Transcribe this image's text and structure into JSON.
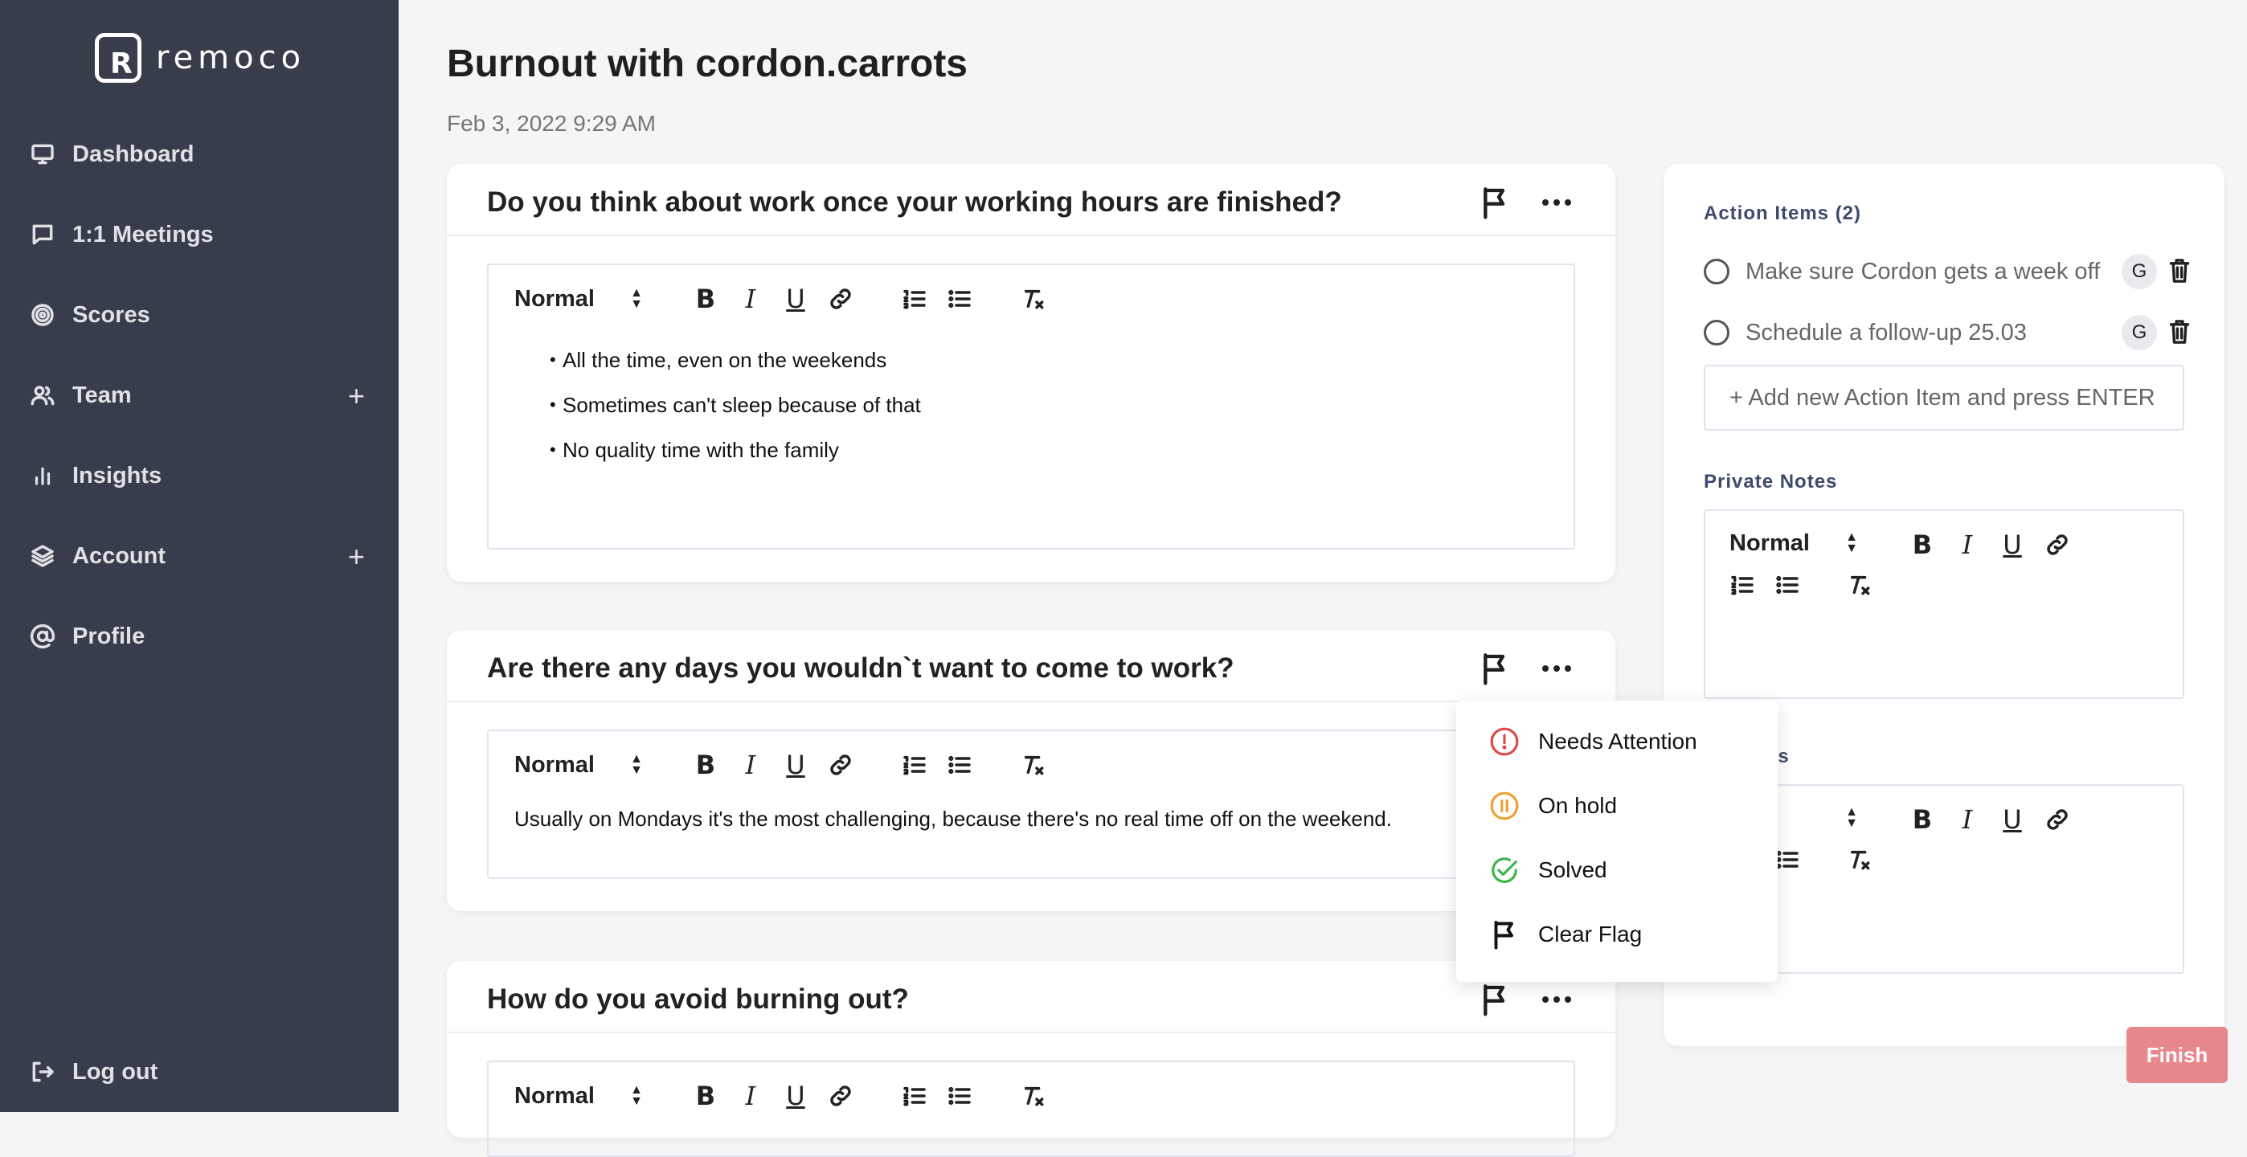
{
  "brand": {
    "name": "remoco",
    "mark": "R"
  },
  "sidebar": {
    "items": [
      {
        "label": "Dashboard",
        "icon": "monitor-icon"
      },
      {
        "label": "1:1 Meetings",
        "icon": "chat-icon"
      },
      {
        "label": "Scores",
        "icon": "target-icon"
      },
      {
        "label": "Team",
        "icon": "users-icon",
        "expand": "+"
      },
      {
        "label": "Insights",
        "icon": "bar-chart-icon"
      },
      {
        "label": "Account",
        "icon": "layers-icon",
        "expand": "+"
      },
      {
        "label": "Profile",
        "icon": "at-icon"
      }
    ],
    "logout": "Log out"
  },
  "meeting": {
    "title": "Burnout with cordon.carrots",
    "date": "Feb 3, 2022 9:29 AM"
  },
  "toolbar": {
    "format": "Normal",
    "bold": "B",
    "italic": "I",
    "underline": "U"
  },
  "questions": [
    {
      "question": "Do you think about work once your working hours are finished?",
      "bullets": [
        "All the time, even on the weekends",
        "Sometimes can't sleep because of that",
        "No quality time with the family"
      ]
    },
    {
      "question": "Are there any days you wouldn`t want to come to work?",
      "text": "Usually on Mondays it's the most challenging, because there's no real time off on the weekend."
    },
    {
      "question": "How do you avoid burning out?"
    }
  ],
  "flag_menu": {
    "items": [
      {
        "label": "Needs Attention",
        "color": "#e04848"
      },
      {
        "label": "On hold",
        "color": "#f0a030"
      },
      {
        "label": "Solved",
        "color": "#3cb54a"
      },
      {
        "label": "Clear Flag",
        "color": "#222222"
      }
    ]
  },
  "right_panel": {
    "action_items_title": "Action Items (2)",
    "action_items": [
      {
        "text": "Make sure Cordon gets a week off",
        "assignee": "G"
      },
      {
        "text": "Schedule a follow-up 25.03",
        "assignee": "G"
      }
    ],
    "add_placeholder": "+ Add new Action Item and press ENTER",
    "private_notes_title": "Private Notes",
    "shared_notes_title_visible": "Notes",
    "shared_notes_format_visible": "rmal"
  },
  "finish_label": "Finish",
  "colors": {
    "sidebar_bg": "#373d4a",
    "finish_bg": "#e8878c",
    "accent_title": "#3d4a6b"
  }
}
